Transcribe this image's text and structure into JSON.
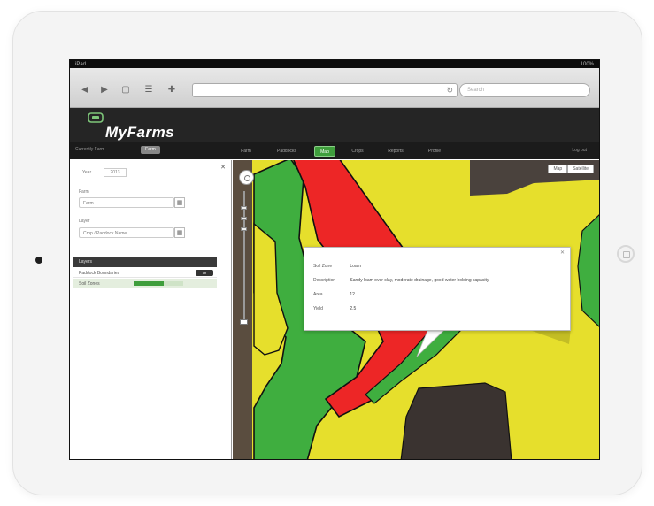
{
  "device": {
    "type": "tablet"
  },
  "status_bar": {
    "left": "iPad",
    "right": "100%"
  },
  "browser": {
    "url": "",
    "search_placeholder": "Search",
    "controls": [
      "◀",
      "▶",
      "▢",
      "☰",
      "✚"
    ]
  },
  "app": {
    "name": "MyFarms"
  },
  "nav": {
    "farm_label": "Currently Farm",
    "farm_value": "Farm",
    "items": [
      {
        "label": "Farm",
        "active": false
      },
      {
        "label": "Paddocks",
        "active": false
      },
      {
        "label": "Map",
        "active": true
      },
      {
        "label": "Crops",
        "active": false
      },
      {
        "label": "Reports",
        "active": false
      },
      {
        "label": "Profile",
        "active": false
      }
    ],
    "right_label": "Log out"
  },
  "left_panel": {
    "year_label": "Year",
    "year_value": "2013",
    "field1_label": "Farm",
    "field1_value": "Farm",
    "field2_label": "Layer",
    "field2_value": "Crop / Paddock Name",
    "layers_header": "Layers",
    "layers": [
      {
        "name": "Paddock Boundaries",
        "button": "on"
      },
      {
        "name": "Soil Zones",
        "level": 0.6
      }
    ]
  },
  "map": {
    "toggle": [
      "Map",
      "Satellite"
    ],
    "colors": {
      "green": "#3fae3f",
      "red": "#ed2626",
      "yellow": "#e6df2c",
      "dark": "#3a3330"
    },
    "popup": {
      "rows": [
        {
          "key": "Soil Zone",
          "value": "Loam"
        },
        {
          "key": "Description",
          "value": "Sandy loam over clay, moderate drainage, good water holding capacity"
        },
        {
          "key": "Area",
          "value": "12"
        },
        {
          "key": "Yield",
          "value": "2.5"
        }
      ]
    }
  }
}
